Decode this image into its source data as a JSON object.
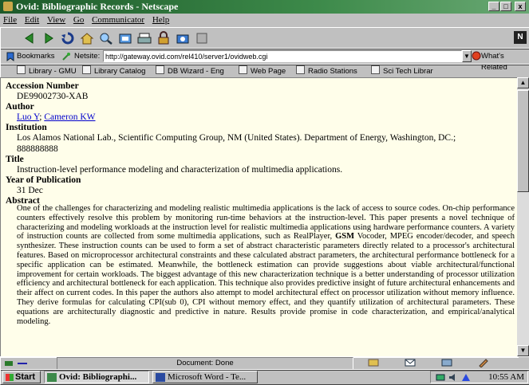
{
  "window": {
    "title": "Ovid: Bibliographic Records - Netscape"
  },
  "window_buttons": {
    "minimize": "_",
    "maximize": "□",
    "close": "x"
  },
  "menu": [
    "File",
    "Edit",
    "View",
    "Go",
    "Communicator",
    "Help"
  ],
  "nav_icons": [
    "back-icon",
    "forward-icon",
    "reload-icon",
    "home-icon",
    "search-icon",
    "netscape-guide-icon",
    "print-icon",
    "security-icon",
    "shop-icon",
    "stop-icon"
  ],
  "location_bar": {
    "bookmarks_label": "Bookmarks",
    "netsite_label": "Netsite:",
    "url": "http://gateway.ovid.com/rel410/server1/ovidweb.cgi",
    "whats_related": "What's Related"
  },
  "personal_toolbar": [
    "Library - GMU",
    "Library Catalog",
    "DB Wizard - Eng",
    "Web Page",
    "Radio Stations",
    "Sci Tech Librar"
  ],
  "record": {
    "accession_label": "Accession Number",
    "accession_value": "DE99002730-XAB",
    "author_label": "Author",
    "author_1": "Luo Y",
    "author_sep": ";",
    "author_2": "Cameron KW",
    "institution_label": "Institution",
    "institution_value": "Los Alamos National Lab., Scientific Computing Group, NM (United States). Department of Energy, Washington, DC.; 888888888",
    "title_label": "Title",
    "title_value": "Instruction-level performance modeling and characterization of multimedia applications.",
    "year_label": "Year of Publication",
    "year_value": "31 Dec",
    "abstract_label": "Abstract",
    "abstract_pre": "One of the challenges for characterizing and modeling realistic multimedia applications is the lack of access to source codes. On-chip performance counters effectively resolve this problem by monitoring run-time behaviors at the instruction-level. This paper presents a novel technique of characterizing and modeling workloads at the instruction level for realistic multimedia applications using hardware performance counters. A variety of instruction counts are collected from some multimedia applications, such as RealPlayer,",
    "abstract_bold": "GSM",
    "abstract_post": "Vocoder, MPEG encoder/decoder, and speech synthesizer. These instruction counts can be used to form a set of abstract characteristic parameters directly related to a processor's architectural features. Based on microprocessor architectural constraints and these calculated abstract parameters, the architectural performance bottleneck for a specific application can be estimated. Meanwhile, the bottleneck estimation can provide suggestions about viable architectural/functional improvement for certain workloads. The biggest advantage of this new characterization technique is a better understanding of processor utilization efficiency and architectural bottleneck for each application. This technique also provides predictive insight of future architectural enhancements and their affect on current codes. In this paper the authors also attempt to model architectural effect on processor utilization without memory influence. They derive formulas for calculating CPI(sub 0), CPI without memory effect, and they quantify utilization of architectural parameters. These equations are architecturally diagnostic and predictive in nature. Results provide promise in code characterization, and empirical/analytical modeling."
  },
  "status": {
    "text": "Document: Done"
  },
  "taskbar": {
    "start": "Start",
    "tasks": [
      "Ovid: Bibliographi...",
      "Microsoft Word - Te..."
    ],
    "clock": "10:55 AM"
  },
  "colors": {
    "title_bar": "#2e7a3c",
    "content_bg": "#fffeea",
    "link": "#0000cc",
    "chrome": "#c0c0c0"
  }
}
